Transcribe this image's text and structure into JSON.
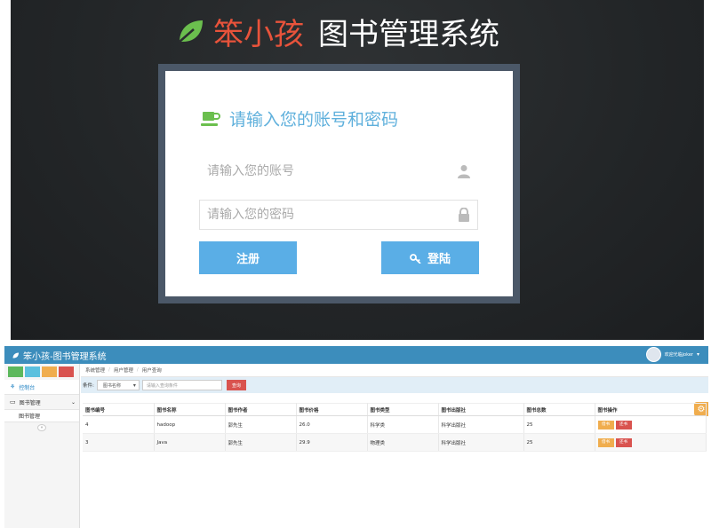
{
  "login": {
    "brand_name": "笨小孩",
    "brand_system": "图书管理系统",
    "card_title": "请输入您的账号和密码",
    "username_placeholder": "请输入您的账号",
    "password_placeholder": "请输入您的密码",
    "register_label": "注册",
    "login_label": "登陆"
  },
  "admin": {
    "app_title": "笨小孩-图书管理系统",
    "user_greeting": "欢迎光临joker",
    "quick_colors": [
      "#5cb85c",
      "#5bc0de",
      "#f0ad4e",
      "#d9534f"
    ],
    "sidebar": {
      "items": [
        {
          "label": "控制台"
        },
        {
          "label": "图书管理"
        },
        {
          "label": "图书管理"
        }
      ]
    },
    "breadcrumb": [
      "系统管理",
      "用户管理",
      "用户查询"
    ],
    "filter": {
      "label": "条件:",
      "select_value": "图书名称",
      "query_placeholder": "请输入查询条件",
      "query_button": "查询"
    },
    "table": {
      "headers": [
        "图书编号",
        "图书名称",
        "图书作者",
        "图书价格",
        "图书类型",
        "图书出版社",
        "图书总数",
        "图书操作"
      ],
      "rows": [
        [
          "4",
          "hadoop",
          "郭先生",
          "26.0",
          "科学类",
          "科学出版社",
          "25"
        ],
        [
          "3",
          "Java",
          "郭先生",
          "29.9",
          "物理类",
          "科学出版社",
          "25"
        ]
      ],
      "borrow_label": "借书",
      "return_label": "还书"
    }
  }
}
